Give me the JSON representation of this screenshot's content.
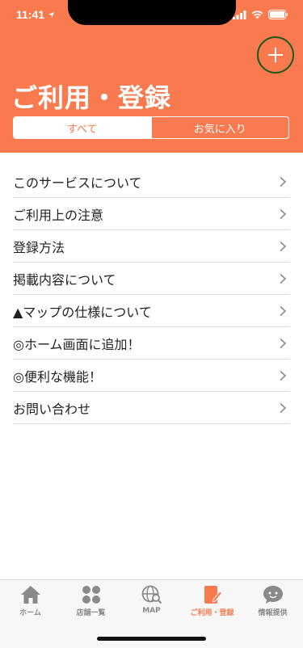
{
  "status_bar": {
    "time": "11:41"
  },
  "header": {
    "title": "ご利用・登録",
    "segments": [
      {
        "label": "すべて",
        "selected": true
      },
      {
        "label": "お気に入り",
        "selected": false
      }
    ],
    "add_icon": "plus-icon"
  },
  "list": {
    "items": [
      {
        "label": "このサービスについて"
      },
      {
        "label": "ご利用上の注意"
      },
      {
        "label": "登録方法"
      },
      {
        "label": "掲載内容について"
      },
      {
        "label": "▲マップの仕様について"
      },
      {
        "label": "◎ホーム画面に追加！"
      },
      {
        "label": "◎便利な機能！"
      },
      {
        "label": "お問い合わせ"
      }
    ]
  },
  "tabbar": {
    "tabs": [
      {
        "label": "ホーム",
        "icon": "home-icon",
        "active": false
      },
      {
        "label": "店舗一覧",
        "icon": "grid-dots-icon",
        "active": false
      },
      {
        "label": "MAP",
        "icon": "globe-search-icon",
        "active": false
      },
      {
        "label": "ご利用・登録",
        "icon": "document-pen-icon",
        "active": true
      },
      {
        "label": "情報提供",
        "icon": "chat-bubble-icon",
        "active": false
      }
    ]
  },
  "colors": {
    "accent": "#f97a4e",
    "tab_inactive": "#8a8a8a"
  }
}
